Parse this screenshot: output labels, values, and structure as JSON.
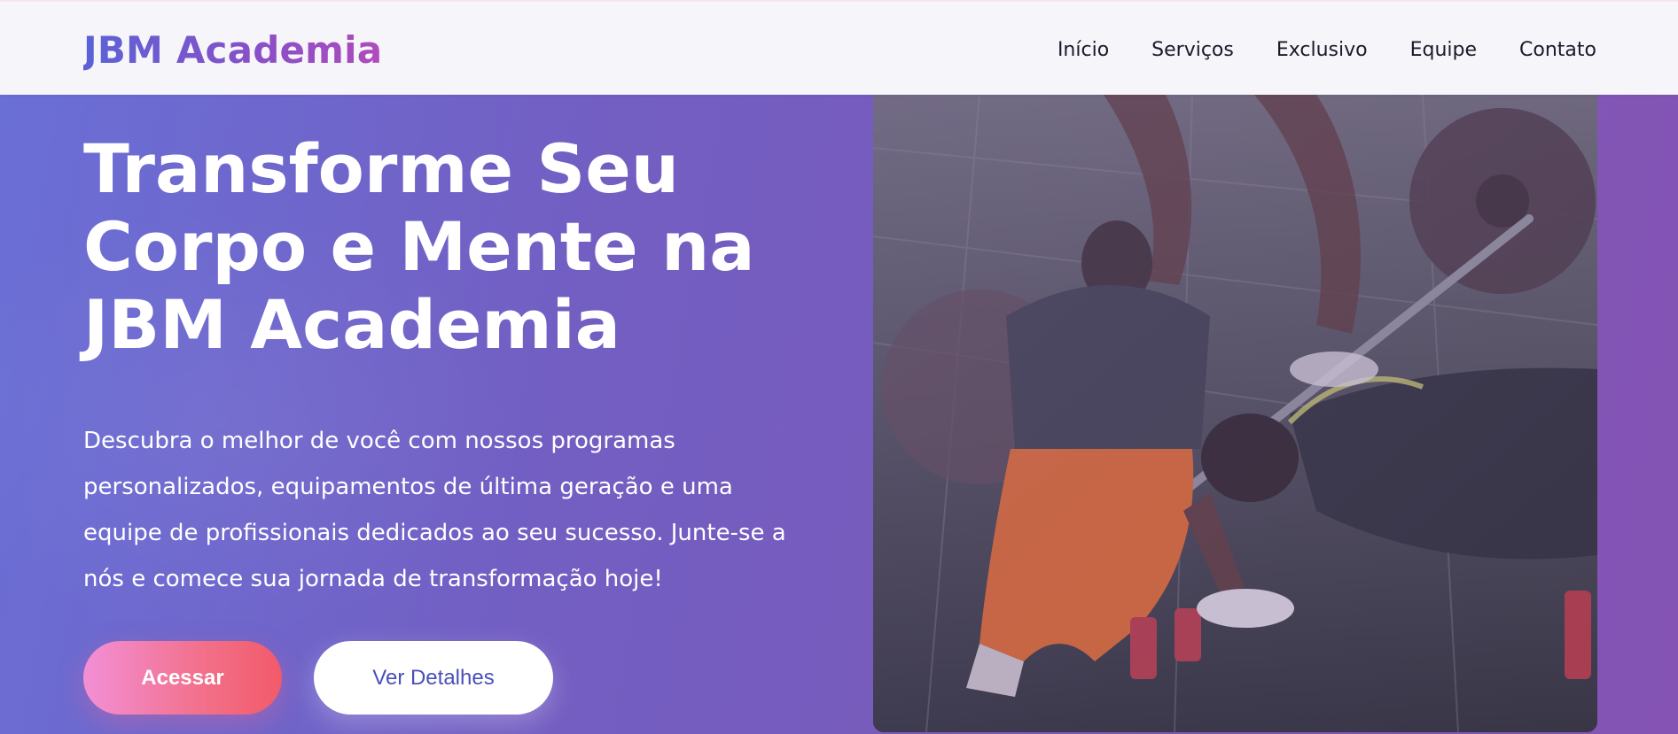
{
  "brand": {
    "logo": "JBM Academia"
  },
  "nav": {
    "items": [
      {
        "label": "Início"
      },
      {
        "label": "Serviços"
      },
      {
        "label": "Exclusivo"
      },
      {
        "label": "Equipe"
      },
      {
        "label": "Contato"
      }
    ]
  },
  "hero": {
    "title": "Transforme Seu Corpo e Mente na JBM Academia",
    "description": "Descubra o melhor de você com nossos programas personalizados, equipamentos de última geração e uma equipe de profissionais dedicados ao seu sucesso. Junte-se a nós e comece sua jornada de transformação hoje!",
    "primary_button": "Acessar",
    "secondary_button": "Ver Detalhes",
    "image_icon": "gym-training-photo"
  },
  "colors": {
    "nav_background": "#f6f6fa",
    "hero_gradient_start": "#6a6fd6",
    "hero_gradient_end": "#8553b4",
    "primary_button_start": "#f38fd6",
    "primary_button_end": "#f25a6a",
    "secondary_button_text": "#4a4fb8"
  }
}
